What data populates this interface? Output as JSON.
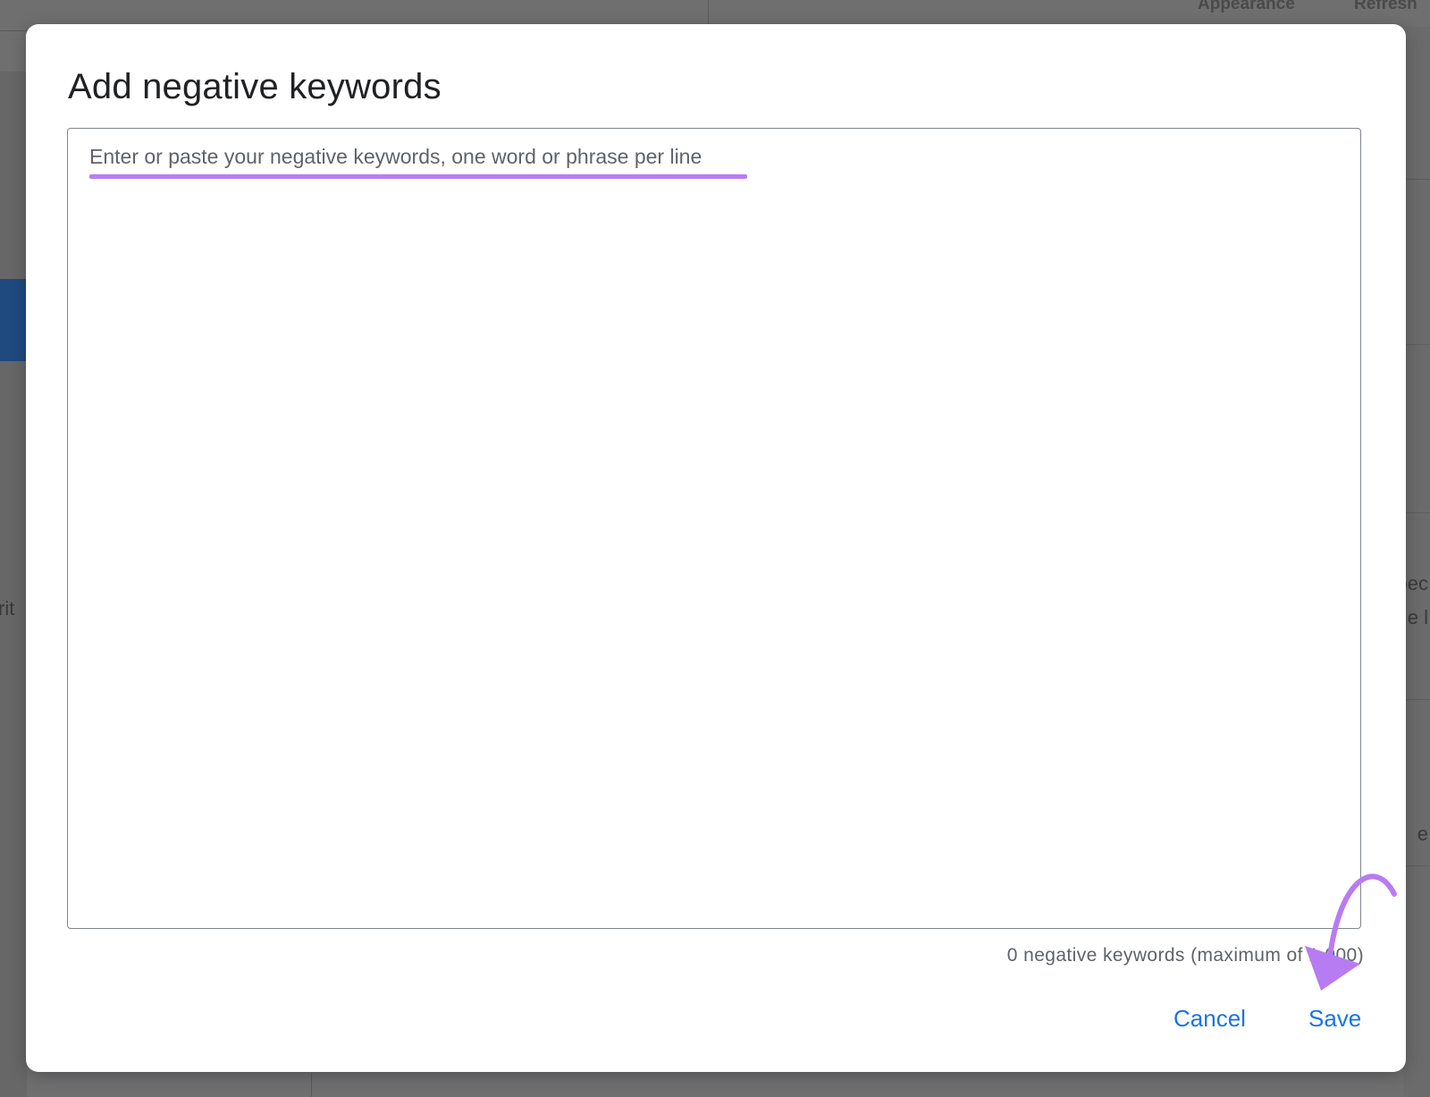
{
  "background": {
    "top_tabs": [
      "Appearance",
      "Refresh"
    ],
    "left_partial_text": "rit",
    "right_partial_texts": [
      "pec",
      "e l",
      "e"
    ]
  },
  "dialog": {
    "title": "Add negative keywords",
    "textarea": {
      "placeholder": "Enter or paste your negative keywords, one word or phrase per line",
      "value": ""
    },
    "counter": "0 negative keywords (maximum of 1,000)",
    "cancel_label": "Cancel",
    "save_label": "Save"
  },
  "colors": {
    "accent": "#1a73e8",
    "highlight": "#b87cf2",
    "overlay": "#6f6f70"
  }
}
